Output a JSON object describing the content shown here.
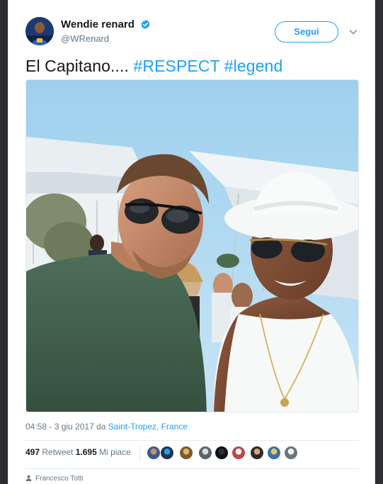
{
  "tweet": {
    "author_name": "Wendie renard",
    "author_handle": "@WRenard",
    "follow_label": "Segui",
    "text_plain": "El Capitano.... ",
    "hashtag_1": "#RESPECT",
    "hashtag_2": "#legend",
    "time": "04:58 - 3 giu 2017 da ",
    "location": "Saint-Tropez, France",
    "retweet_count": "497",
    "retweet_label": " Retweet ",
    "like_count": "1.695",
    "like_label": " Mi piace",
    "tagged_person": "Francesco Totti"
  },
  "icons": {
    "verified": "verified-badge-icon",
    "more": "chevron-down-icon",
    "tagged": "person-icon"
  },
  "colors": {
    "accent": "#1da1f2",
    "text": "#14171a",
    "muted": "#657786"
  }
}
